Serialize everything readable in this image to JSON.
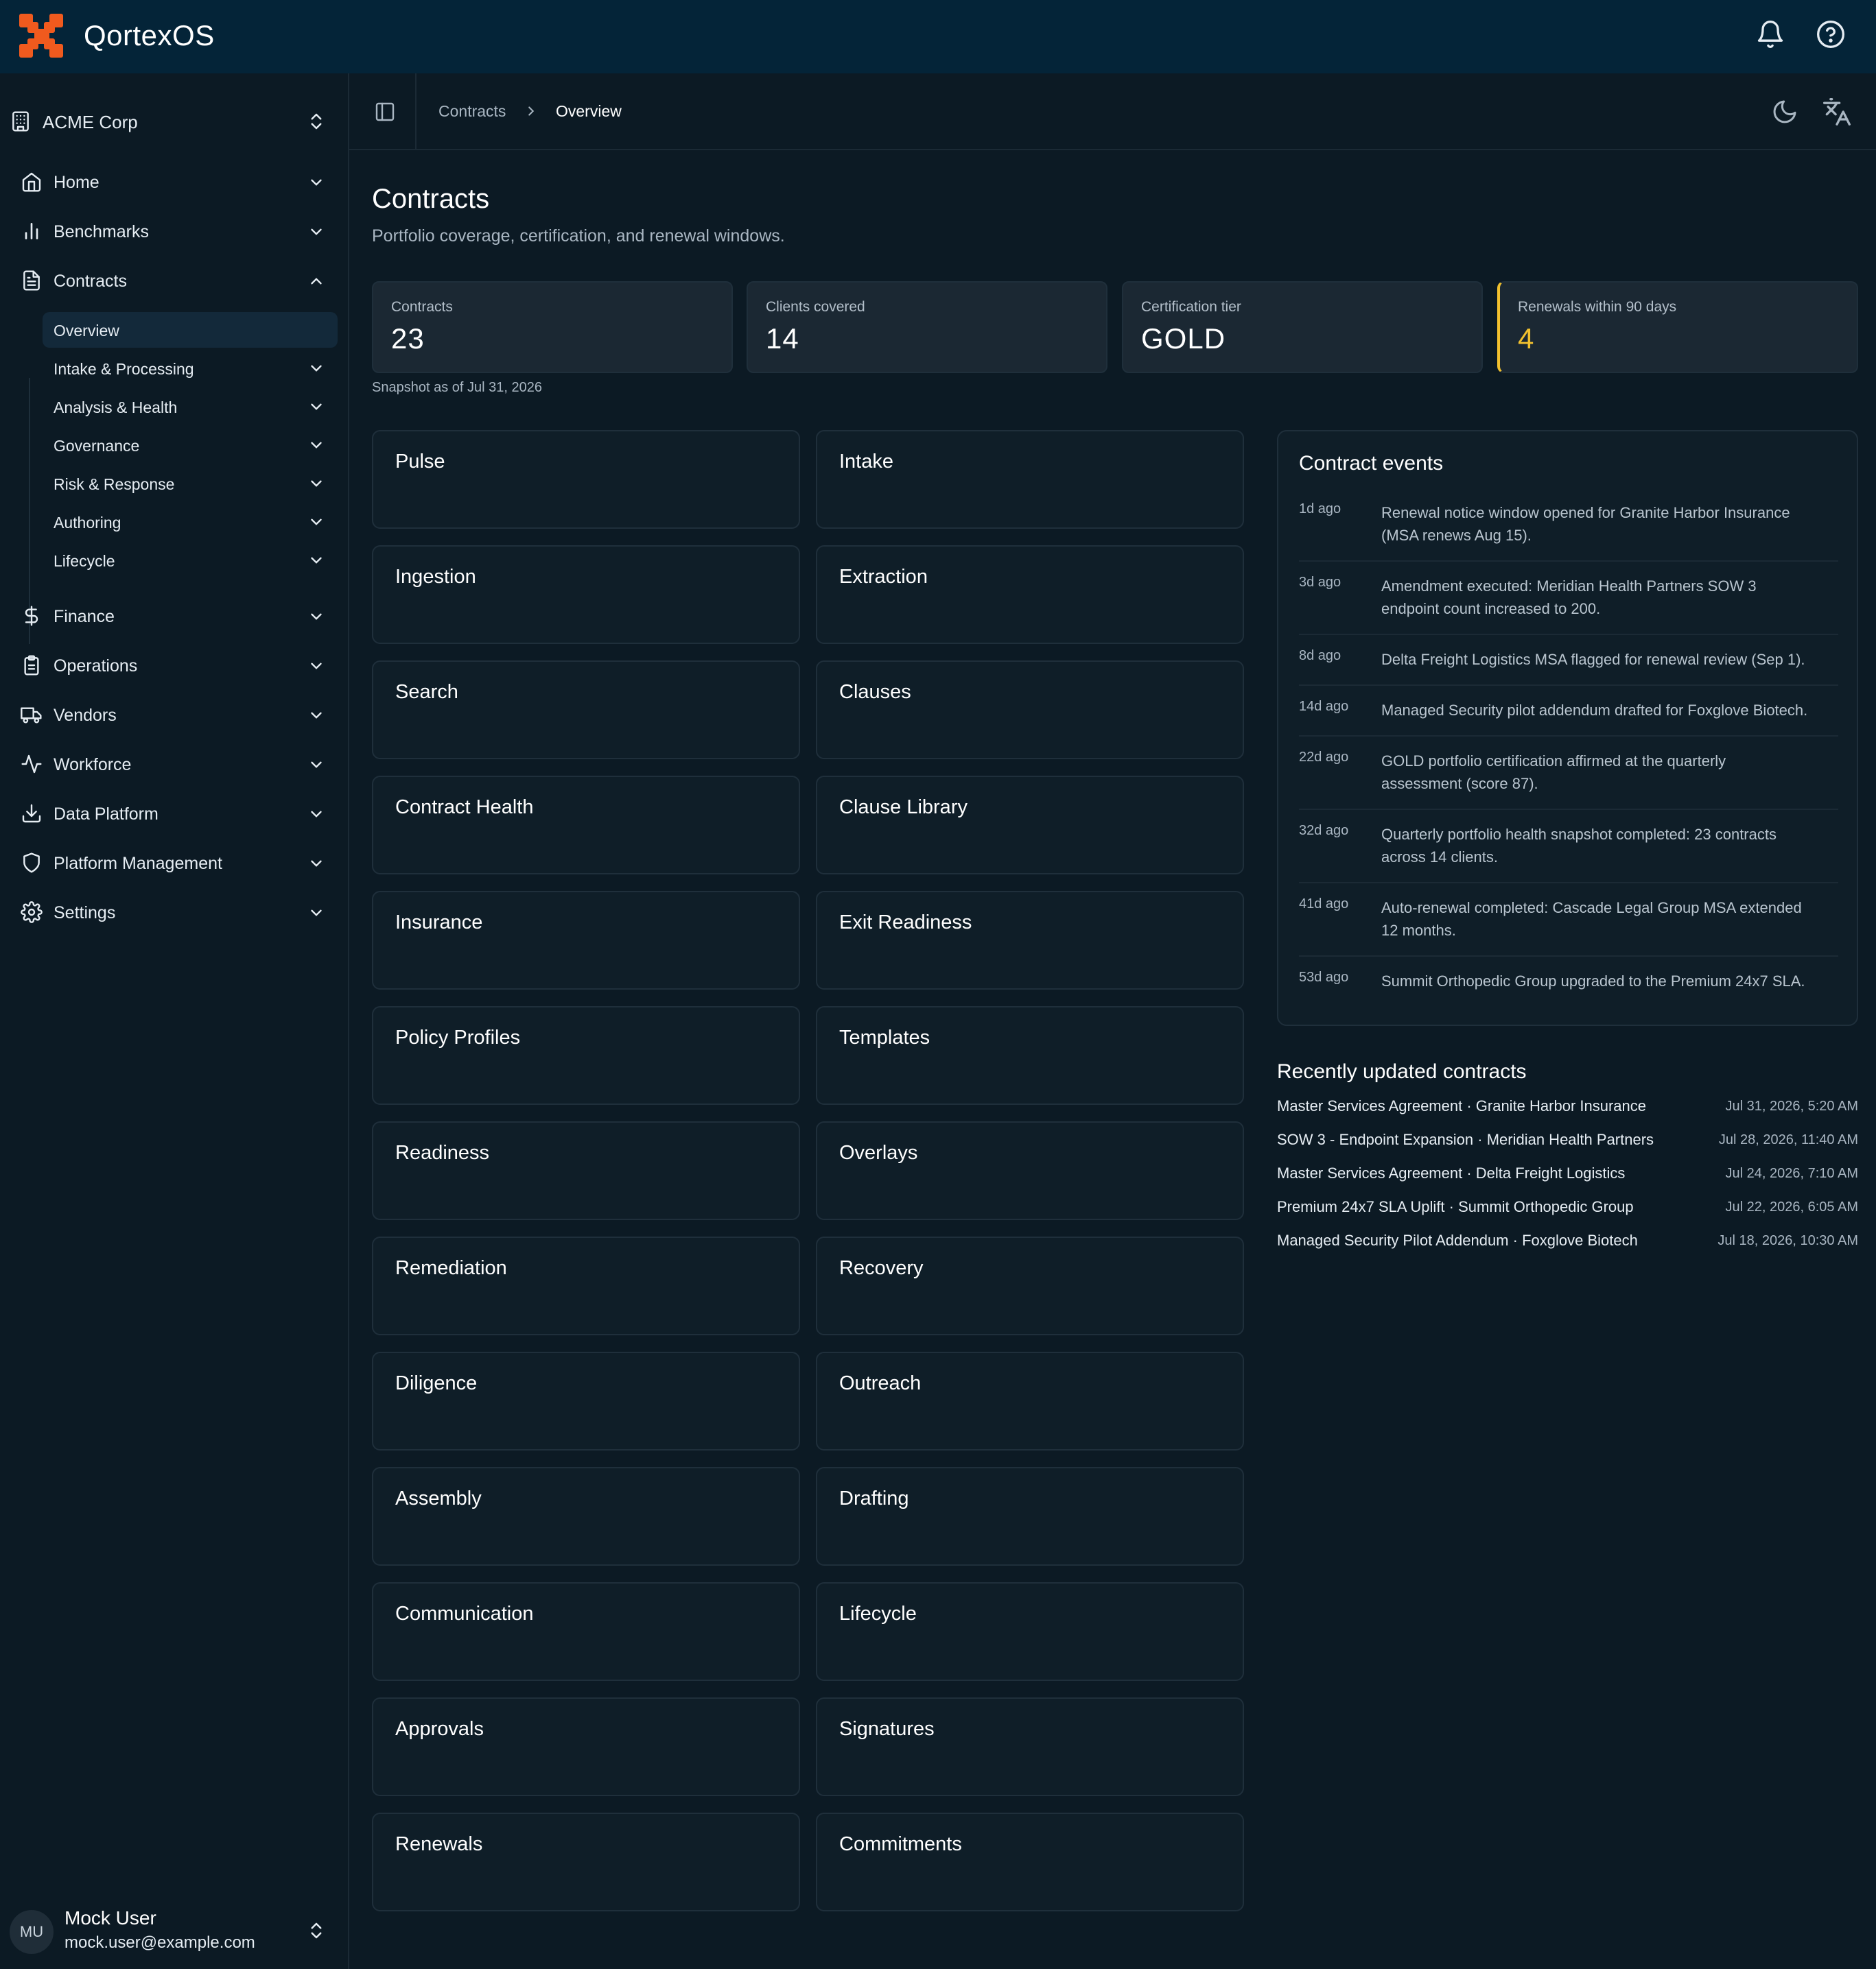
{
  "app": {
    "brand": "QortexOS"
  },
  "colors": {
    "accent": "#f2c12e",
    "brand_orange": "#f05a1e",
    "topbar": "#042438"
  },
  "sidebar": {
    "org": "ACME Corp",
    "items": [
      {
        "label": "Home",
        "icon": "home-icon"
      },
      {
        "label": "Benchmarks",
        "icon": "bar-chart-icon"
      },
      {
        "label": "Contracts",
        "icon": "document-icon",
        "expanded": true
      },
      {
        "label": "Finance",
        "icon": "dollar-icon"
      },
      {
        "label": "Operations",
        "icon": "clipboard-icon"
      },
      {
        "label": "Vendors",
        "icon": "truck-icon"
      },
      {
        "label": "Workforce",
        "icon": "activity-icon"
      },
      {
        "label": "Data Platform",
        "icon": "download-icon"
      },
      {
        "label": "Platform Management",
        "icon": "shield-icon"
      },
      {
        "label": "Settings",
        "icon": "gear-icon"
      }
    ],
    "contracts_sub": [
      {
        "label": "Overview",
        "active": true
      },
      {
        "label": "Intake & Processing"
      },
      {
        "label": "Analysis & Health"
      },
      {
        "label": "Governance"
      },
      {
        "label": "Risk & Response"
      },
      {
        "label": "Authoring"
      },
      {
        "label": "Lifecycle"
      }
    ],
    "user": {
      "initials": "MU",
      "name": "Mock User",
      "email": "mock.user@example.com"
    }
  },
  "breadcrumb": {
    "parent": "Contracts",
    "current": "Overview"
  },
  "page": {
    "title": "Contracts",
    "subtitle": "Portfolio coverage, certification, and renewal windows."
  },
  "stats": [
    {
      "label": "Contracts",
      "value": "23"
    },
    {
      "label": "Clients covered",
      "value": "14"
    },
    {
      "label": "Certification tier",
      "value": "GOLD"
    },
    {
      "label": "Renewals within 90 days",
      "value": "4"
    }
  ],
  "snapshot": "Snapshot as of Jul 31, 2026",
  "modules": [
    "Pulse",
    "Intake",
    "Ingestion",
    "Extraction",
    "Search",
    "Clauses",
    "Contract Health",
    "Clause Library",
    "Insurance",
    "Exit Readiness",
    "Policy Profiles",
    "Templates",
    "Readiness",
    "Overlays",
    "Remediation",
    "Recovery",
    "Diligence",
    "Outreach",
    "Assembly",
    "Drafting",
    "Communication",
    "Lifecycle",
    "Approvals",
    "Signatures",
    "Renewals",
    "Commitments"
  ],
  "events": {
    "title": "Contract events",
    "items": [
      {
        "age": "1d ago",
        "line1": "Renewal notice window opened for Granite Harbor Insurance",
        "line2": "(MSA renews Aug 15)."
      },
      {
        "age": "3d ago",
        "line1": "Amendment executed: Meridian Health Partners SOW 3",
        "line2": "endpoint count increased to 200."
      },
      {
        "age": "8d ago",
        "line1": "Delta Freight Logistics MSA flagged for renewal review (Sep 1).",
        "line2": ""
      },
      {
        "age": "14d ago",
        "line1": "Managed Security pilot addendum drafted for Foxglove Biotech.",
        "line2": ""
      },
      {
        "age": "22d ago",
        "line1": "GOLD portfolio certification affirmed at the quarterly",
        "line2": "assessment (score 87)."
      },
      {
        "age": "32d ago",
        "line1": "Quarterly portfolio health snapshot completed: 23 contracts",
        "line2": "across 14 clients."
      },
      {
        "age": "41d ago",
        "line1": "Auto-renewal completed: Cascade Legal Group MSA extended",
        "line2": "12 months."
      },
      {
        "age": "53d ago",
        "line1": "Summit Orthopedic Group upgraded to the Premium 24x7 SLA.",
        "line2": ""
      }
    ]
  },
  "recent": {
    "title": "Recently updated contracts",
    "items": [
      {
        "name": "Master Services Agreement · Granite Harbor Insurance",
        "date": "Jul 31, 2026, 5:20 AM"
      },
      {
        "name": "SOW 3 - Endpoint Expansion · Meridian Health Partners",
        "date": "Jul 28, 2026, 11:40 AM"
      },
      {
        "name": "Master Services Agreement · Delta Freight Logistics",
        "date": "Jul 24, 2026, 7:10 AM"
      },
      {
        "name": "Premium 24x7 SLA Uplift · Summit Orthopedic Group",
        "date": "Jul 22, 2026, 6:05 AM"
      },
      {
        "name": "Managed Security Pilot Addendum · Foxglove Biotech",
        "date": "Jul 18, 2026, 10:30 AM"
      }
    ]
  }
}
